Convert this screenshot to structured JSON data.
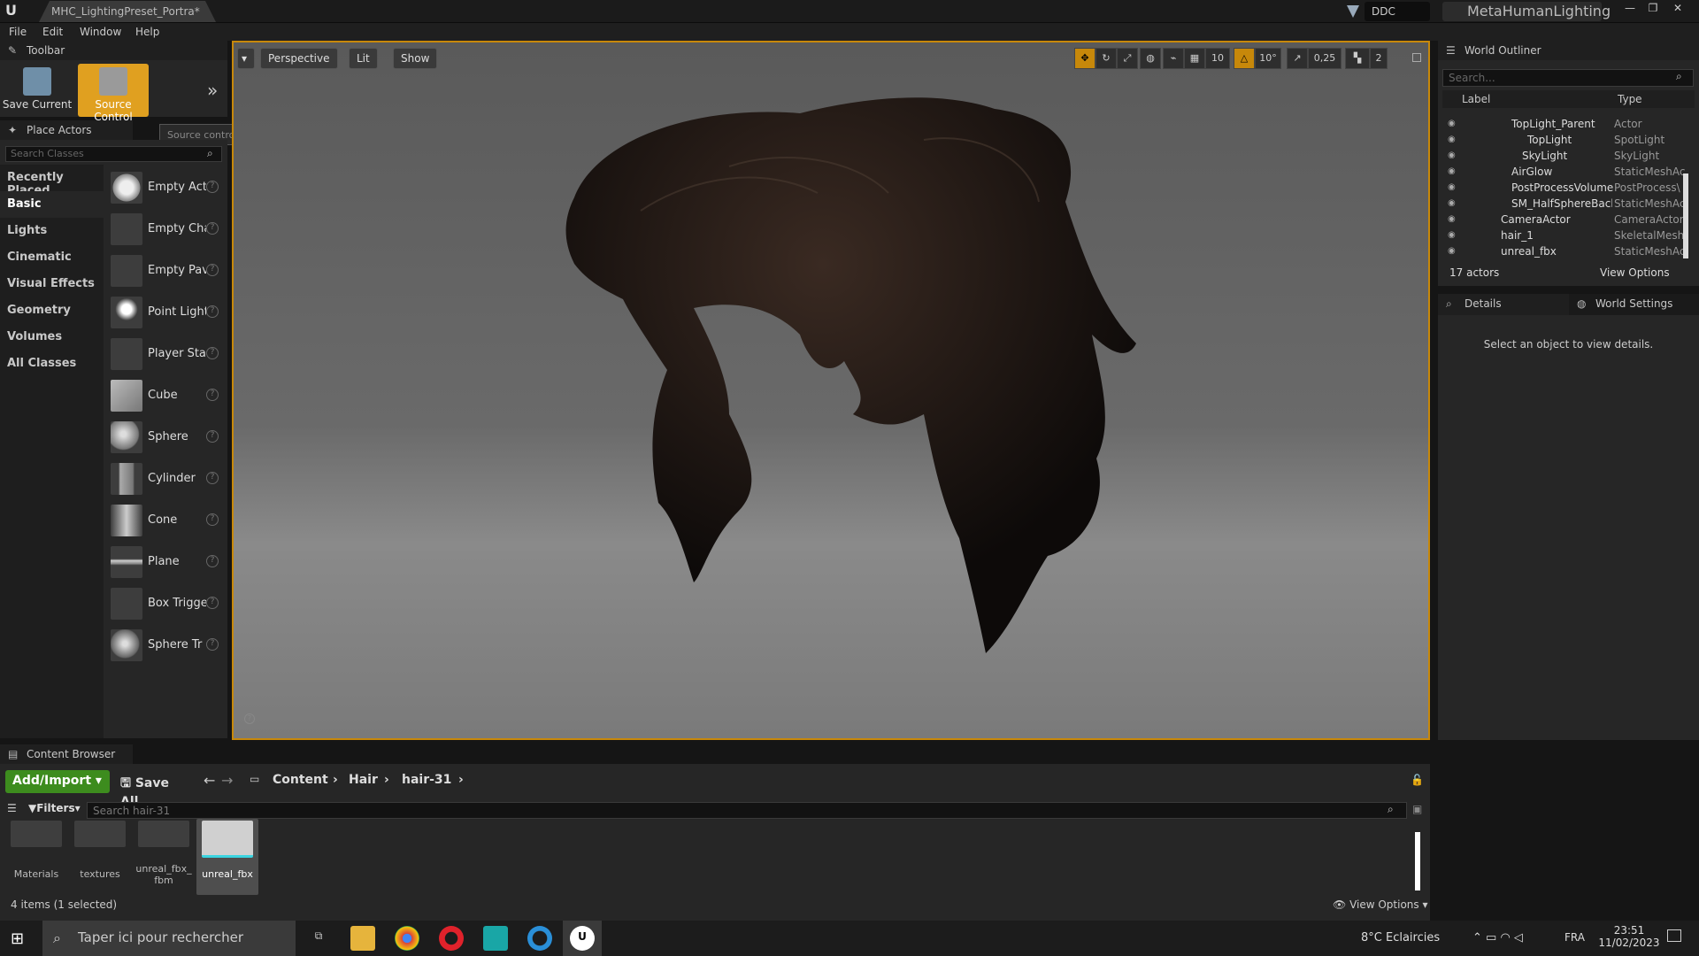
{
  "window": {
    "doc_tab": "MHC_LightingPreset_Portra*",
    "ddc_label": "DDC",
    "project": "MetaHumanLighting"
  },
  "menu": [
    "File",
    "Edit",
    "Window",
    "Help"
  ],
  "toolbar": {
    "title": "Toolbar",
    "save": "Save Current",
    "source": "Source Control",
    "tooltip": "Source control is disabled"
  },
  "place": {
    "title": "Place Actors",
    "search_placeholder": "Search Classes",
    "categories": [
      "Recently Placed",
      "Basic",
      "Lights",
      "Cinematic",
      "Visual Effects",
      "Geometry",
      "Volumes",
      "All Classes"
    ],
    "items": [
      "Empty Act",
      "Empty Cha",
      "Empty Pav",
      "Point Light",
      "Player Sta",
      "Cube",
      "Sphere",
      "Cylinder",
      "Cone",
      "Plane",
      "Box Trigge",
      "Sphere Tr"
    ]
  },
  "viewport": {
    "perspective": "Perspective",
    "lit": "Lit",
    "show": "Show",
    "grid": "10",
    "rot": "10°",
    "scale": "0,25",
    "cam": "2"
  },
  "outliner": {
    "title": "World Outliner",
    "search_placeholder": "Search...",
    "col_label": "Label",
    "col_type": "Type",
    "rows": [
      {
        "label": "TopLight_Parent",
        "type": "Actor"
      },
      {
        "label": "TopLight",
        "type": "SpotLight"
      },
      {
        "label": "SkyLight",
        "type": "SkyLight"
      },
      {
        "label": "AirGlow",
        "type": "StaticMeshAc"
      },
      {
        "label": "PostProcessVolume",
        "type": "PostProcess\\"
      },
      {
        "label": "SM_HalfSphereBackg",
        "type": "StaticMeshAc"
      },
      {
        "label": "CameraActor",
        "type": "CameraActor"
      },
      {
        "label": "hair_1",
        "type": "SkeletalMesh"
      },
      {
        "label": "unreal_fbx",
        "type": "StaticMeshAc"
      }
    ],
    "count": "17 actors",
    "view_options": "View Options"
  },
  "details": {
    "tab1": "Details",
    "tab2": "World Settings",
    "empty": "Select an object to view details."
  },
  "content": {
    "title": "Content Browser",
    "add": "Add/Import",
    "save_all": "Save All",
    "crumbs": [
      "Content",
      "Hair",
      "hair-31"
    ],
    "filters": "Filters",
    "search_placeholder": "Search hair-31",
    "assets": [
      "Materials",
      "textures",
      "unreal_fbx_\nfbm",
      "unreal_fbx"
    ],
    "status": "4 items (1 selected)",
    "view_options": "View Options"
  },
  "taskbar": {
    "search": "Taper ici pour rechercher",
    "weather": "8°C  Eclaircies",
    "lang": "FRA",
    "time": "23:51",
    "date": "11/02/2023"
  }
}
